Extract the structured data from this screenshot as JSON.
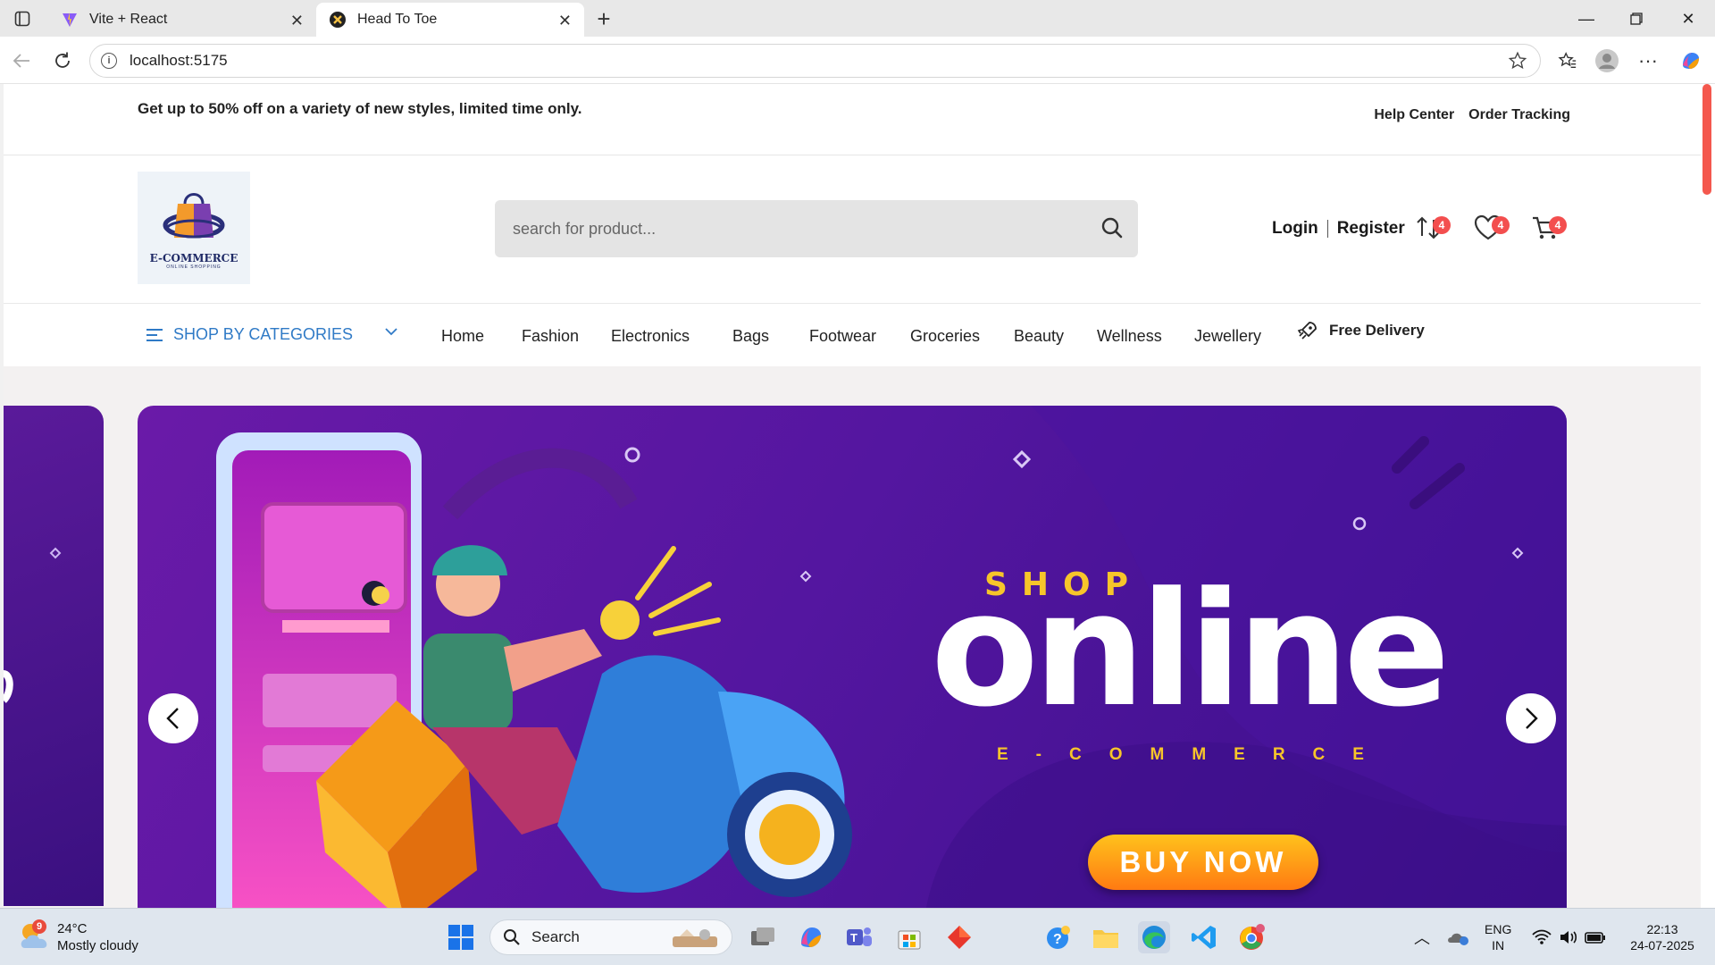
{
  "browser": {
    "tabs": [
      {
        "title": "Vite + React",
        "icon": "vite-icon",
        "active": false
      },
      {
        "title": "Head To Toe",
        "icon": "site-favicon",
        "active": true
      }
    ],
    "url": "localhost:5175"
  },
  "promo": {
    "text": "Get up to 50% off on a variety of new styles, limited time only.",
    "links": [
      "Help Center",
      "Order Tracking"
    ]
  },
  "header": {
    "logo_text": "E-COMMERCE",
    "logo_subtext": "ONLINE SHOPPING",
    "search_placeholder": "search for product...",
    "login": "Login",
    "register": "Register",
    "compare_count": "4",
    "wishlist_count": "4",
    "cart_count": "4"
  },
  "nav": {
    "categories_label": "SHOP BY CATEGORIES",
    "links": [
      "Home",
      "Fashion",
      "Electronics",
      "Bags",
      "Footwear",
      "Groceries",
      "Beauty",
      "Wellness",
      "Jewellery"
    ],
    "free_delivery": "Free Delivery"
  },
  "banner": {
    "shop": "SHOP",
    "online": "online",
    "ecommerce": "E-COMMERCE",
    "cta": "BUY NOW"
  },
  "taskbar": {
    "weather_badge": "9",
    "temperature": "24°C",
    "condition": "Mostly cloudy",
    "search_label": "Search",
    "lang_top": "ENG",
    "lang_bottom": "IN",
    "time": "22:13",
    "date": "24-07-2025"
  },
  "colors": {
    "accent_blue": "#2f7ac6",
    "badge_red": "#f34e4e",
    "banner_purple": "#5416a0",
    "banner_yellow": "#f7c52a"
  }
}
